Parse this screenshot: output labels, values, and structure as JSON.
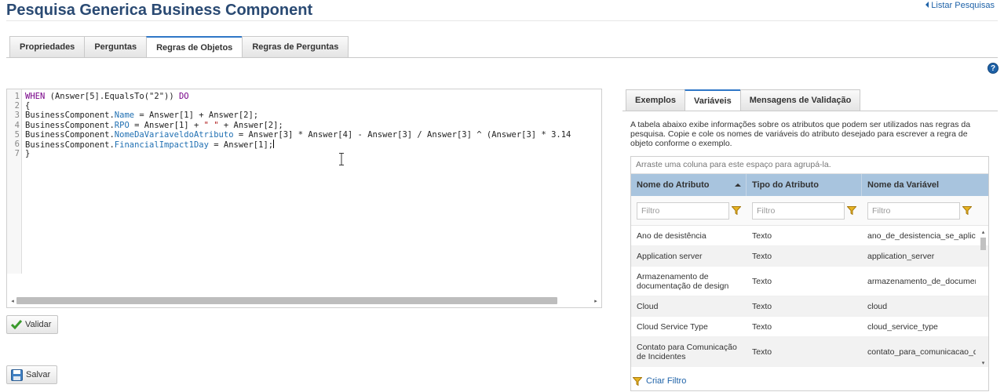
{
  "header": {
    "title": "Pesquisa Generica Business Component",
    "list_link": "Listar Pesquisas"
  },
  "tabs": [
    {
      "label": "Propriedades",
      "active": false
    },
    {
      "label": "Perguntas",
      "active": false
    },
    {
      "label": "Regras de Objetos",
      "active": true
    },
    {
      "label": "Regras de Perguntas",
      "active": false
    }
  ],
  "help_icon": "?",
  "editor": {
    "lines": [
      {
        "n": "1",
        "parts": [
          {
            "t": "WHEN",
            "c": "kw"
          },
          {
            "t": " (Answer[5].EqualsTo(\"2\")) ",
            "c": ""
          },
          {
            "t": "DO",
            "c": "kw"
          }
        ]
      },
      {
        "n": "2",
        "parts": [
          {
            "t": "{",
            "c": ""
          }
        ]
      },
      {
        "n": "3",
        "parts": [
          {
            "t": "BusinessComponent.",
            "c": ""
          },
          {
            "t": "Name",
            "c": "prop"
          },
          {
            "t": " = Answer[1] + Answer[2];",
            "c": ""
          }
        ]
      },
      {
        "n": "4",
        "parts": [
          {
            "t": "BusinessComponent.",
            "c": ""
          },
          {
            "t": "RPO",
            "c": "prop"
          },
          {
            "t": " = Answer[1] + ",
            "c": ""
          },
          {
            "t": "\" \"",
            "c": "str"
          },
          {
            "t": " + Answer[2];",
            "c": ""
          }
        ]
      },
      {
        "n": "5",
        "parts": [
          {
            "t": "BusinessComponent.",
            "c": ""
          },
          {
            "t": "NomeDaVariaveldoAtributo",
            "c": "prop"
          },
          {
            "t": " = Answer[3] * Answer[4] - Answer[3] / Answer[3] ^ (Answer[3] * 3.14",
            "c": ""
          }
        ]
      },
      {
        "n": "6",
        "parts": [
          {
            "t": "BusinessComponent.",
            "c": ""
          },
          {
            "t": "FinancialImpact1Day",
            "c": "prop"
          },
          {
            "t": " = Answer[1];",
            "c": ""
          }
        ]
      },
      {
        "n": "7",
        "parts": [
          {
            "t": "}",
            "c": ""
          }
        ]
      }
    ]
  },
  "buttons": {
    "validar": "Validar",
    "salvar": "Salvar"
  },
  "right_tabs": [
    {
      "label": "Exemplos",
      "active": false
    },
    {
      "label": "Variáveis",
      "active": true
    },
    {
      "label": "Mensagens de Validação",
      "active": false
    }
  ],
  "description": "A tabela abaixo exibe informações sobre os atributos que podem ser utilizados nas regras da pesquisa. Copie e cole os nomes de variáveis do atributo desejado para escrever a regra de objeto conforme o exemplo.",
  "grid": {
    "group_hint": "Arraste uma coluna para este espaço para agrupá-la.",
    "columns": [
      "Nome do Atributo",
      "Tipo do Atributo",
      "Nome da Variável"
    ],
    "filter_placeholder": "Filtro",
    "rows": [
      [
        "Ano de desistência",
        "Texto",
        "ano_de_desistencia_se_aplica"
      ],
      [
        "Application server",
        "Texto",
        "application_server"
      ],
      [
        "Armazenamento de documentação de design",
        "Texto",
        "armazenamento_de_documen"
      ],
      [
        "Cloud",
        "Texto",
        "cloud"
      ],
      [
        "Cloud Service Type",
        "Texto",
        "cloud_service_type"
      ],
      [
        "Contato para Comunicação de Incidentes",
        "Texto",
        "contato_para_comunicacao_d"
      ]
    ],
    "create_filter": "Criar Filtro"
  },
  "colors": {
    "title": "#2a4a73",
    "link": "#1e62a8",
    "grid_header": "#a8c4de",
    "tab_accent": "#2f77c7"
  }
}
